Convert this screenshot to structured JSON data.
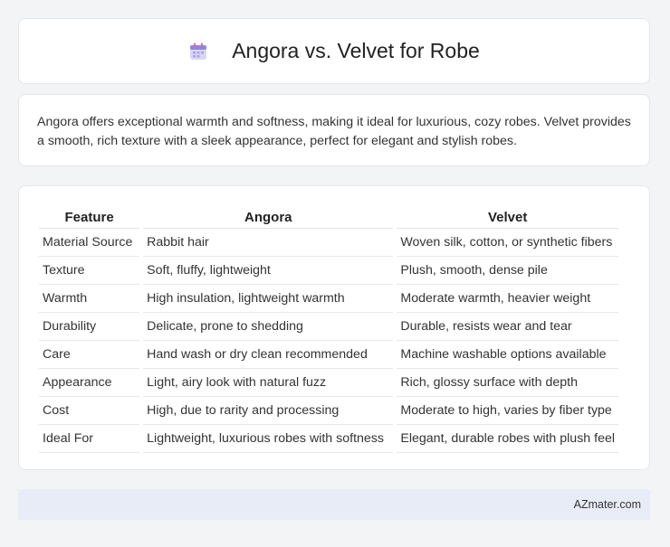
{
  "header": {
    "title": "Angora vs. Velvet for Robe",
    "icon": "calendar-icon"
  },
  "summary": {
    "text": "Angora offers exceptional warmth and softness, making it ideal for luxurious, cozy robes. Velvet provides a smooth, rich texture with a sleek appearance, perfect for elegant and stylish robes."
  },
  "table": {
    "headers": [
      "Feature",
      "Angora",
      "Velvet"
    ],
    "rows": [
      [
        "Material Source",
        "Rabbit hair",
        "Woven silk, cotton, or synthetic fibers"
      ],
      [
        "Texture",
        "Soft, fluffy, lightweight",
        "Plush, smooth, dense pile"
      ],
      [
        "Warmth",
        "High insulation, lightweight warmth",
        "Moderate warmth, heavier weight"
      ],
      [
        "Durability",
        "Delicate, prone to shedding",
        "Durable, resists wear and tear"
      ],
      [
        "Care",
        "Hand wash or dry clean recommended",
        "Machine washable options available"
      ],
      [
        "Appearance",
        "Light, airy look with natural fuzz",
        "Rich, glossy surface with depth"
      ],
      [
        "Cost",
        "High, due to rarity and processing",
        "Moderate to high, varies by fiber type"
      ],
      [
        "Ideal For",
        "Lightweight, luxurious robes with softness",
        "Elegant, durable robes with plush feel"
      ]
    ]
  },
  "footer": {
    "brand": "AZmater.com"
  }
}
